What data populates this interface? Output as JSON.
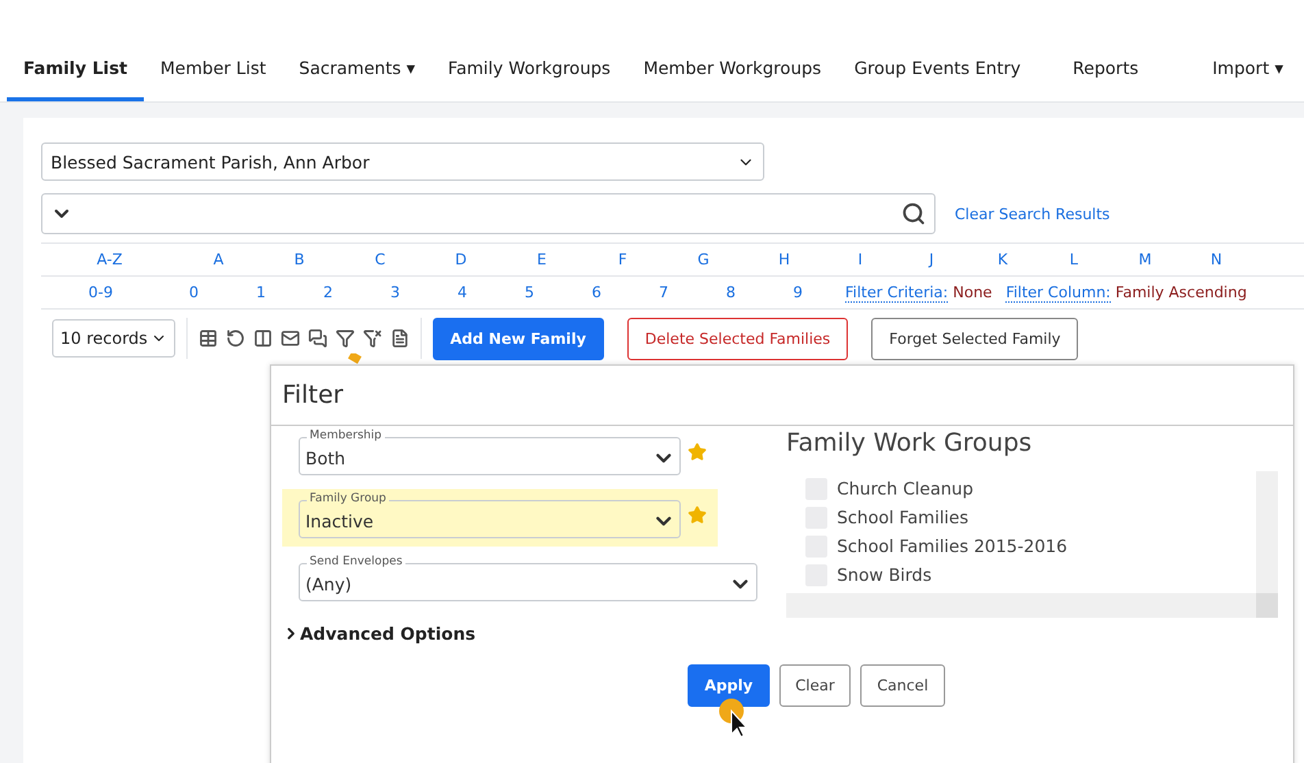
{
  "tabs": [
    {
      "label": "Family List",
      "selected": true
    },
    {
      "label": "Member List",
      "selected": false
    },
    {
      "label": "Sacraments",
      "selected": false,
      "caret": "▾"
    },
    {
      "label": "Family Workgroups",
      "selected": false
    },
    {
      "label": "Member Workgroups",
      "selected": false
    },
    {
      "label": "Group Events Entry",
      "selected": false
    },
    {
      "label": "Reports",
      "selected": false
    },
    {
      "label": "Import",
      "selected": false,
      "caret": "▾"
    }
  ],
  "parish_select": {
    "value": "Blessed Sacrament Parish, Ann Arbor"
  },
  "clear_search_link": "Clear Search Results",
  "letters": [
    "A-Z",
    "A",
    "B",
    "C",
    "D",
    "E",
    "F",
    "G",
    "H",
    "I",
    "J",
    "K",
    "L",
    "M",
    "N"
  ],
  "digits": [
    "0-9",
    "0",
    "1",
    "2",
    "3",
    "4",
    "5",
    "6",
    "7",
    "8",
    "9"
  ],
  "filter_info": [
    {
      "label": "Filter Criteria:",
      "value": "None"
    },
    {
      "label": "Filter Column:",
      "value": "Family Ascending"
    }
  ],
  "records_select": "10 records",
  "buttons": [
    {
      "label": "Add New Family",
      "kind": "primary"
    },
    {
      "label": "Delete Selected Families",
      "kind": "danger"
    },
    {
      "label": "Forget Selected Family",
      "kind": "plain"
    }
  ],
  "filter_dialog": {
    "title": "Filter",
    "fields": [
      {
        "label": "Membership",
        "value": "Both",
        "highlighted": false,
        "starred": true
      },
      {
        "label": "Family Group",
        "value": "Inactive",
        "highlighted": true,
        "starred": true
      },
      {
        "label": "Send Envelopes",
        "value": "(Any)",
        "highlighted": false,
        "starred": false
      }
    ],
    "advanced_options": "Advanced Options",
    "groups_title": "Family Work Groups",
    "groups": [
      {
        "label": "Church Cleanup",
        "checked": false
      },
      {
        "label": "School Families",
        "checked": false
      },
      {
        "label": "School Families 2015-2016",
        "checked": false
      },
      {
        "label": "Snow Birds",
        "checked": false
      }
    ],
    "buttons": [
      {
        "label": "Apply",
        "kind": "primary"
      },
      {
        "label": "Clear",
        "kind": "plain"
      },
      {
        "label": "Cancel",
        "kind": "plain"
      }
    ]
  }
}
